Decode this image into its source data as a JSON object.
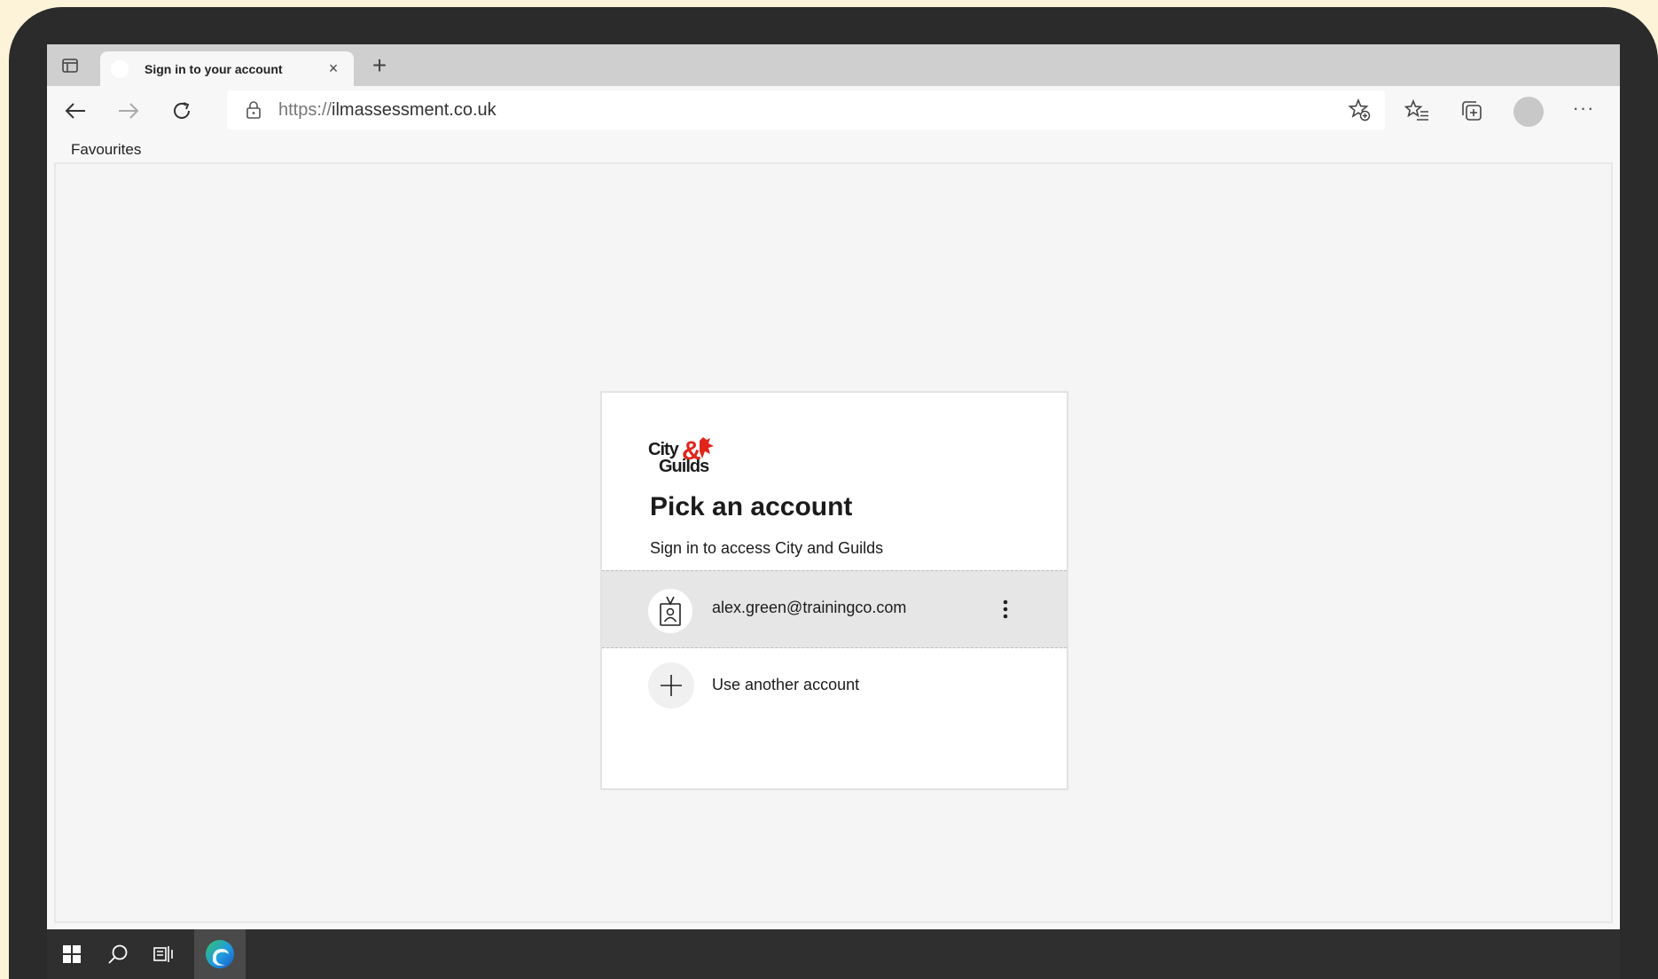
{
  "browser": {
    "tab_title": "Sign in to your account",
    "tab_close": "×",
    "new_tab": "+",
    "url_protocol": "https://",
    "url_host": "ilmassessment.co.uk",
    "more_label": "···",
    "favourites_label": "Favourites"
  },
  "card": {
    "logo_line1": "City&",
    "logo_line2": "Guilds",
    "title": "Pick an account",
    "subtitle": "Sign in to access City and Guilds",
    "accounts": [
      {
        "email": "alex.green@trainingco.com"
      }
    ],
    "other_account_label": "Use another account"
  },
  "colors": {
    "brand_red": "#e1251b",
    "background": "#fcf3d9",
    "device": "#2b2b2b",
    "edge_blue": "#1f7ee0",
    "edge_green": "#38c26a"
  },
  "icons": {
    "tab_actions": "tab-actions-icon",
    "back": "arrow-left-icon",
    "forward": "arrow-right-icon",
    "refresh": "refresh-icon",
    "lock": "lock-icon",
    "favorite_add": "star-add-icon",
    "favorites": "favorites-icon",
    "collections": "collections-icon",
    "account": "person-badge-icon",
    "more_options": "kebab-icon",
    "add": "plus-icon",
    "start": "windows-icon",
    "search": "search-icon",
    "task_view": "task-view-icon",
    "edge": "edge-browser-icon"
  }
}
